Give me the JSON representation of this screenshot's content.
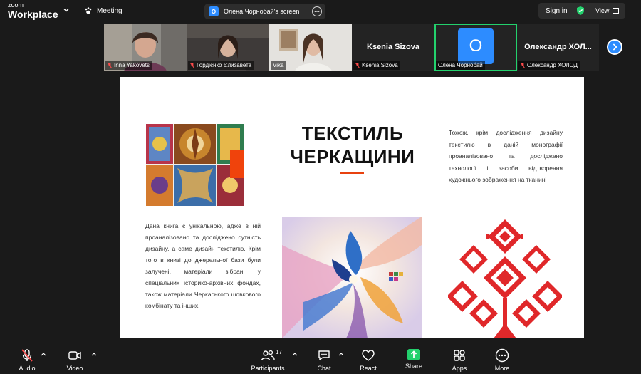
{
  "app": {
    "logo_line1": "zoom",
    "logo_line2": "Workplace",
    "meeting_label": "Meeting"
  },
  "share": {
    "badge": "О",
    "text": "Олена Чорнобай's screen"
  },
  "topright": {
    "signin": "Sign in",
    "view": "View"
  },
  "participants": [
    {
      "name": "Inna Yakovets",
      "muted": true,
      "type": "video"
    },
    {
      "name": "Гордієнко Єлизавета",
      "muted": true,
      "type": "video"
    },
    {
      "name": "Vika",
      "muted": false,
      "type": "video"
    },
    {
      "name": "Ksenia Sizova",
      "big_name": "Ksenia Sizova",
      "muted": true,
      "type": "name"
    },
    {
      "name": "Олена Чорнобай",
      "avatar_letter": "О",
      "muted": false,
      "type": "avatar",
      "active": true
    },
    {
      "name": "Олександр ХОЛОД",
      "big_name": "Олександр  ХОЛ...",
      "muted": true,
      "type": "name"
    }
  ],
  "slide": {
    "title_line1": "ТЕКСТИЛЬ",
    "title_line2": "ЧЕРКАЩИНИ",
    "text_right": "Тожож, крім дослідження дизайну текстилю в даній монографії проаналізовано та досліджено технології і засоби відтворення художнього зображення на тканині",
    "text_left": "Дана книга є унікальною, адже в ній проаналізовано та досліджено сутність дизайну, а саме дизайн текстилю. Крім того в книзі до джерельної бази були залучені, матеріали зібрані у спеціальних історико-архівних фондах, також матеріали Черкаського шовкового комбінату та інших."
  },
  "toolbar": {
    "audio": "Audio",
    "video": "Video",
    "participants": "Participants",
    "participants_count": "17",
    "chat": "Chat",
    "react": "React",
    "share": "Share",
    "apps": "Apps",
    "more": "More"
  },
  "colors": {
    "accent_blue": "#2d8cff",
    "active_green": "#23d16d",
    "slide_orange": "#e8410f",
    "ornament_red": "#e0282a"
  }
}
